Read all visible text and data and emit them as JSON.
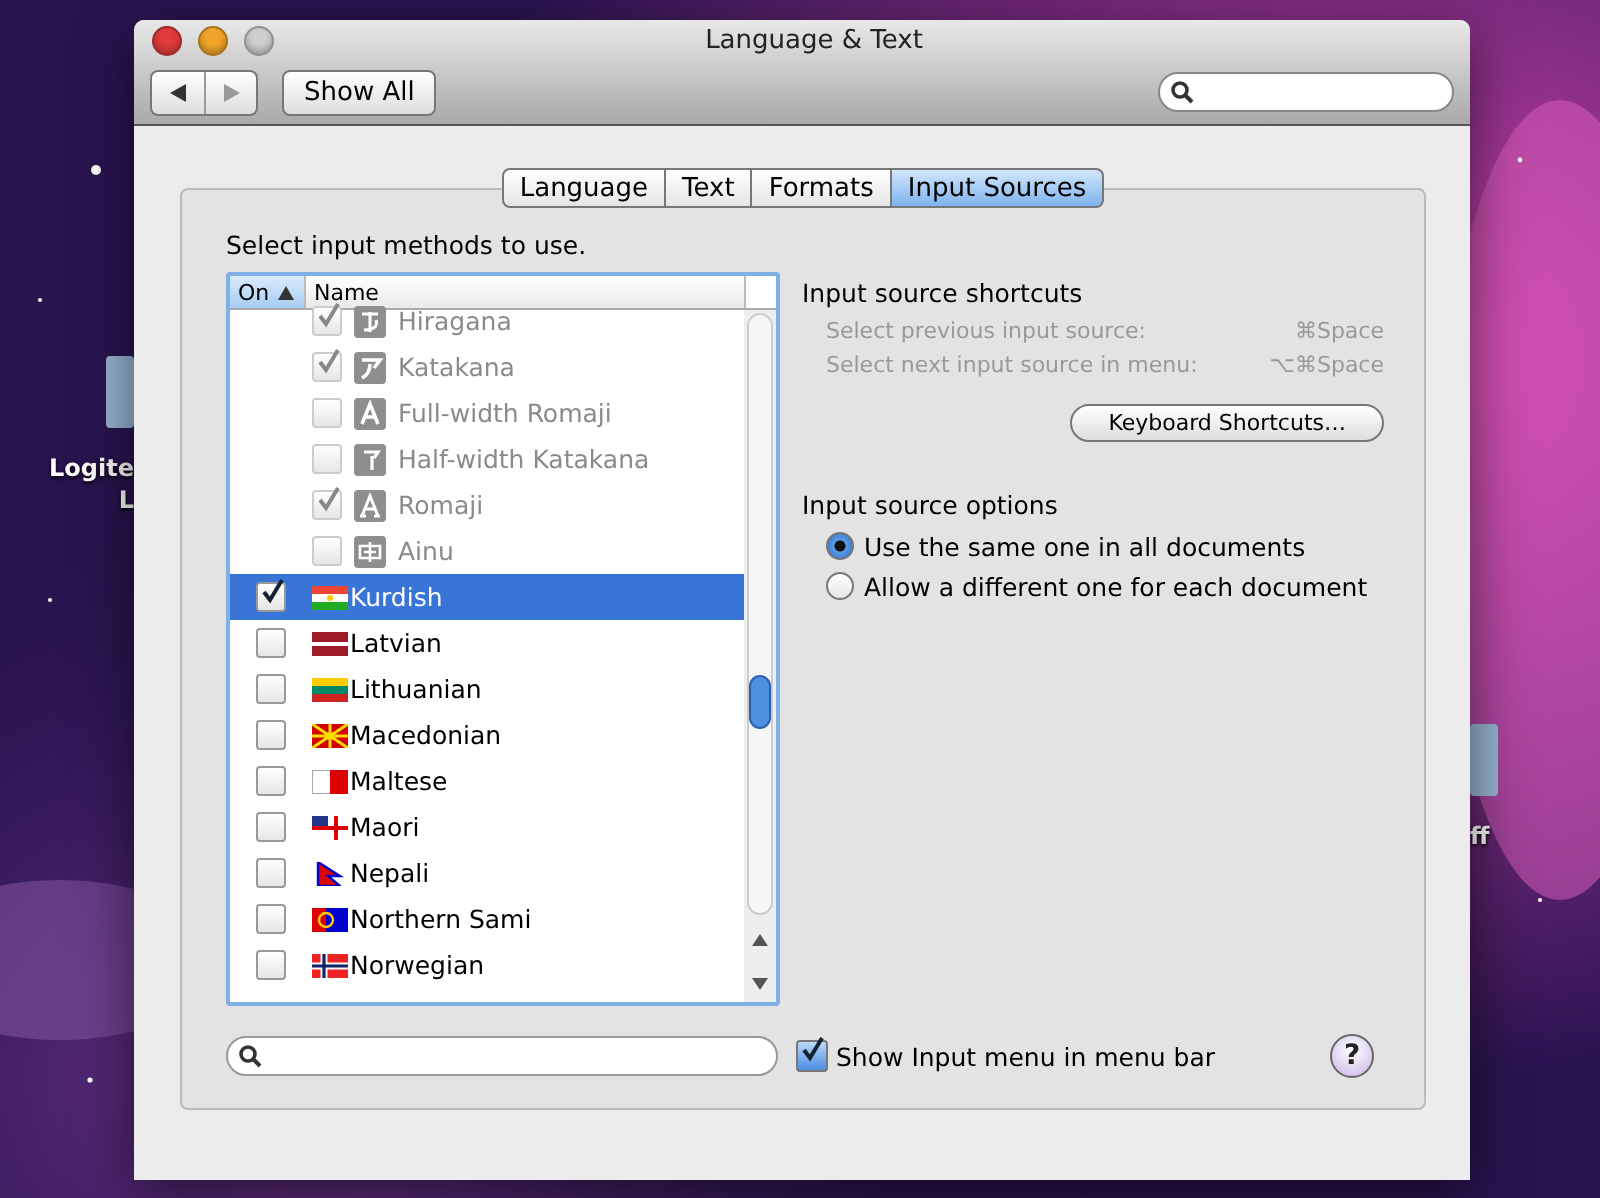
{
  "desktop_icons": [
    {
      "lines": [
        "Logite",
        "L"
      ]
    },
    {
      "lines": [
        "ff"
      ]
    }
  ],
  "window": {
    "title": "Language & Text",
    "show_all": "Show All"
  },
  "tabs": [
    {
      "label": "Language",
      "selected": false
    },
    {
      "label": "Text",
      "selected": false
    },
    {
      "label": "Formats",
      "selected": false
    },
    {
      "label": "Input Sources",
      "selected": true
    }
  ],
  "instruction": "Select input methods to use.",
  "list": {
    "columns": [
      {
        "label": "On",
        "sorted": true
      },
      {
        "label": "Name",
        "sorted": false
      }
    ],
    "items": [
      {
        "kind": "sub",
        "name": "Hiragana",
        "checked": true,
        "disabled": true,
        "selected": false
      },
      {
        "kind": "sub",
        "name": "Katakana",
        "checked": true,
        "disabled": true,
        "selected": false
      },
      {
        "kind": "sub",
        "name": "Full-width Romaji",
        "checked": false,
        "disabled": true,
        "selected": false
      },
      {
        "kind": "sub",
        "name": "Half-width Katakana",
        "checked": false,
        "disabled": true,
        "selected": false
      },
      {
        "kind": "sub",
        "name": "Romaji",
        "checked": true,
        "disabled": true,
        "selected": false
      },
      {
        "kind": "sub",
        "name": "Ainu",
        "checked": false,
        "disabled": true,
        "selected": false
      },
      {
        "kind": "language",
        "name": "Kurdish",
        "checked": true,
        "disabled": false,
        "selected": true
      },
      {
        "kind": "language",
        "name": "Latvian",
        "checked": false,
        "disabled": false,
        "selected": false
      },
      {
        "kind": "language",
        "name": "Lithuanian",
        "checked": false,
        "disabled": false,
        "selected": false
      },
      {
        "kind": "language",
        "name": "Macedonian",
        "checked": false,
        "disabled": false,
        "selected": false
      },
      {
        "kind": "language",
        "name": "Maltese",
        "checked": false,
        "disabled": false,
        "selected": false
      },
      {
        "kind": "language",
        "name": "Maori",
        "checked": false,
        "disabled": false,
        "selected": false
      },
      {
        "kind": "language",
        "name": "Nepali",
        "checked": false,
        "disabled": false,
        "selected": false
      },
      {
        "kind": "language",
        "name": "Northern Sami",
        "checked": false,
        "disabled": false,
        "selected": false
      },
      {
        "kind": "language",
        "name": "Norwegian",
        "checked": false,
        "disabled": false,
        "selected": false
      }
    ]
  },
  "shortcuts": {
    "title": "Input source shortcuts",
    "rows": [
      {
        "label": "Select previous input source:",
        "keys": "⌘Space",
        "disabled": true
      },
      {
        "label": "Select next input source in menu:",
        "keys": "⌥⌘Space",
        "disabled": true
      }
    ],
    "button": "Keyboard Shortcuts…"
  },
  "options": {
    "title": "Input source options",
    "choices": [
      {
        "label": "Use the same one in all documents",
        "selected": true
      },
      {
        "label": "Allow a different one for each document",
        "selected": false
      }
    ]
  },
  "show_menu": {
    "label": "Show Input menu in menu bar",
    "checked": true
  },
  "help": {
    "label": "?"
  }
}
